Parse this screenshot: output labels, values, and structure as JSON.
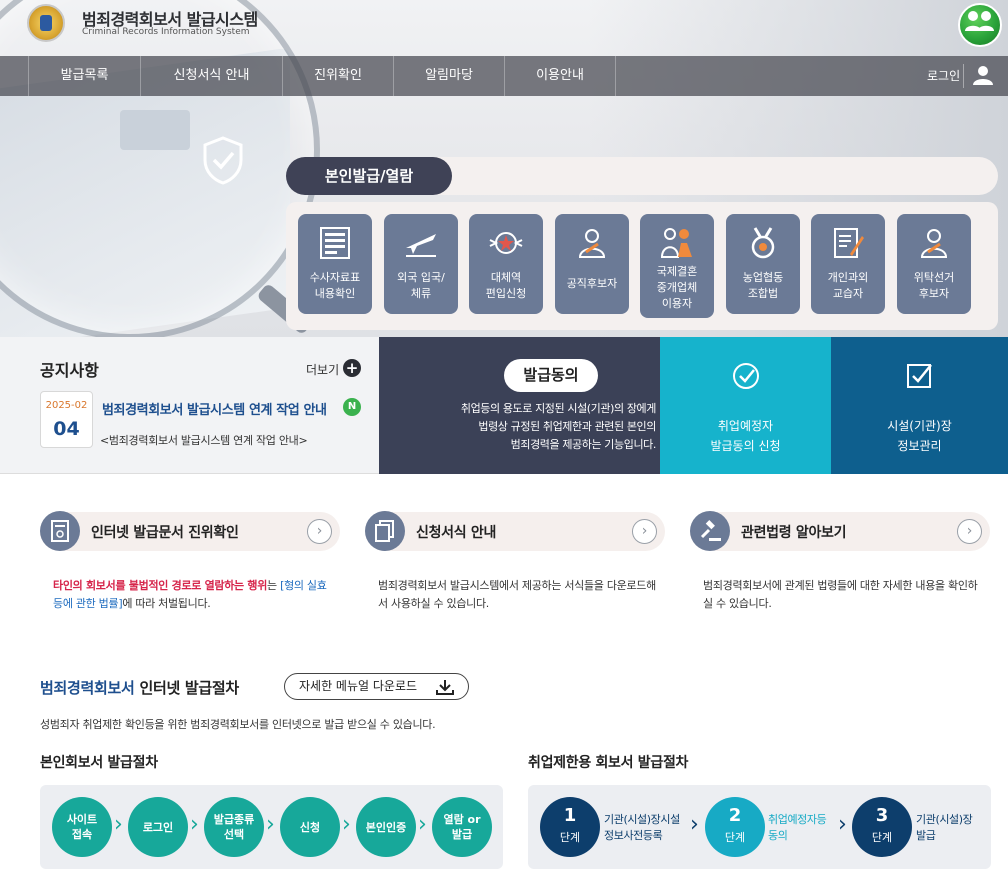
{
  "header": {
    "title": "범죄경력회보서 발급시스템",
    "subtitle": "Criminal Records Information System"
  },
  "nav": {
    "items": [
      "발급목록",
      "신청서식 안내",
      "진위확인",
      "알림마당",
      "이용안내"
    ],
    "login": "로그인"
  },
  "self_issue": {
    "title": "본인발급/열람",
    "tiles": [
      {
        "icon": "document-list-icon",
        "line1": "수사자료표",
        "line2": "내용확인"
      },
      {
        "icon": "airplane-icon",
        "line1": "외국 입국/",
        "line2": "체류"
      },
      {
        "icon": "military-emblem-icon",
        "line1": "대체역",
        "line2": "편입신청"
      },
      {
        "icon": "official-candidate-icon",
        "line1": "공직후보자",
        "line2": ""
      },
      {
        "icon": "couple-icon",
        "line1": "국제결혼",
        "line2": "중개업체",
        "line3": "이용자"
      },
      {
        "icon": "medal-icon",
        "line1": "농업협동",
        "line2": "조합법"
      },
      {
        "icon": "document-pen-icon",
        "line1": "개인과외",
        "line2": "교습자"
      },
      {
        "icon": "entrusted-candidate-icon",
        "line1": "위탁선거",
        "line2": "후보자"
      }
    ]
  },
  "notice": {
    "title": "공지사항",
    "more": "더보기",
    "date_ym": "2025-02",
    "date_d": "04",
    "headline": "범죄경력회보서 발급시스템 연계 작업 안내",
    "badge": "N",
    "sub": "<범죄경력회보서 발급시스템 연계 작업 안내>"
  },
  "consent": {
    "title": "발급동의",
    "desc_line1": "취업등의 용도로 지정된 시설(기관)의 장에게",
    "desc_line2": "법령상 규정된 취업제한과 관련된 본인의",
    "desc_line3": "범죄경력을 제공하는 기능입니다."
  },
  "boxes": {
    "cyan_line1": "취업예정자",
    "cyan_line2": "발급동의 신청",
    "navy_line1": "시설(기관)장",
    "navy_line2": "정보관리"
  },
  "services": [
    {
      "title": "인터넷 발급문서 진위확인",
      "desc_red": "타인의 회보서를 불법적인 경로로 열람하는 행위",
      "desc_mid": "는 ",
      "desc_blue": "[형의 실효등에 관한 법률]",
      "desc_end": "에 따라 처벌됩니다."
    },
    {
      "title": "신청서식 안내",
      "desc": "범죄경력회보서 발급시스템에서 제공하는 서식들을 다운로드해서 사용하실 수 있습니다."
    },
    {
      "title": "관련법령 알아보기",
      "desc": "범죄경력회보서에 관계된 법령들에 대한 자세한 내용을 확인하실 수 있습니다."
    }
  ],
  "procedure": {
    "title_accent": "범죄경력회보서",
    "title_rest": " 인터넷 발급절차",
    "manual_button": "자세한 메뉴얼 다운로드",
    "desc": "성범죄자 취업제한 확인등을 위한 범죄경력회보서를 인터넷으로 발급 받으실 수 있습니다.",
    "self_title": "본인회보서 발급절차",
    "self_steps": [
      {
        "l1": "사이트",
        "l2": "접속"
      },
      {
        "l1": "로그인",
        "l2": ""
      },
      {
        "l1": "발급종류",
        "l2": "선택"
      },
      {
        "l1": "신청",
        "l2": ""
      },
      {
        "l1": "본인인증",
        "l2": ""
      },
      {
        "l1": "열람 or",
        "l2": "발급"
      }
    ],
    "employ_title": "취업제한용 회보서 발급절차",
    "employ_steps": [
      {
        "num": "1",
        "unit": "단계",
        "l1": "기관(시설)장시설",
        "l2": "정보사전등록"
      },
      {
        "num": "2",
        "unit": "단계",
        "l1": "취업예정자등",
        "l2": "동의"
      },
      {
        "num": "3",
        "unit": "단계",
        "l1": "기관(시설)장",
        "l2": "발급"
      }
    ]
  },
  "colors": {
    "tile": "#6b7a96",
    "consent": "#3b4157",
    "cyan": "#16b3cc",
    "navy": "#0e5f8e",
    "teal": "#17a89a",
    "step_navy": "#0d3e6c"
  }
}
